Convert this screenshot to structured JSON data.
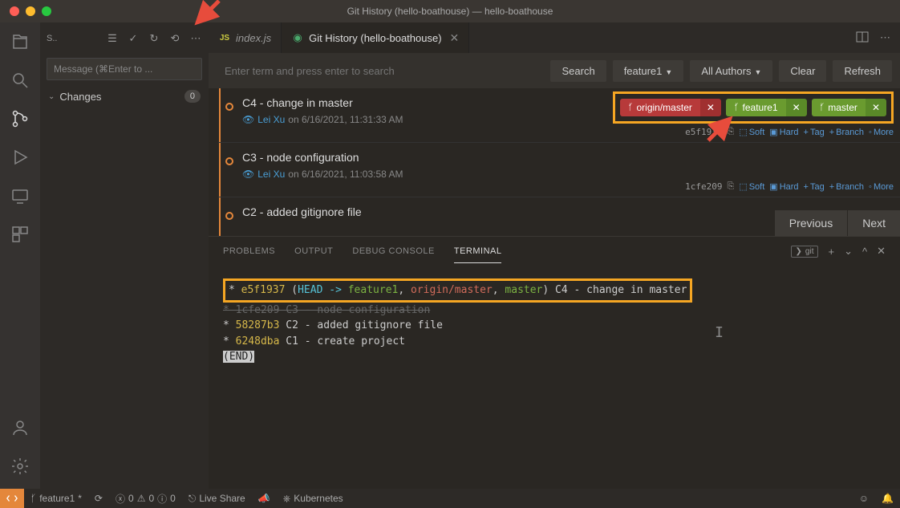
{
  "titlebar": {
    "title": "Git History (hello-boathouse) — hello-boathouse"
  },
  "sidebar": {
    "header_label": "S..",
    "message_placeholder": "Message (⌘Enter to ...",
    "changes_label": "Changes",
    "changes_count": "0"
  },
  "tabs": {
    "t0": {
      "label": "index.js"
    },
    "t1": {
      "label": "Git History (hello-boathouse)"
    }
  },
  "search": {
    "placeholder": "Enter term and press enter to search",
    "btn_search": "Search",
    "btn_branch": "feature1",
    "btn_authors": "All Authors",
    "btn_clear": "Clear",
    "btn_refresh": "Refresh"
  },
  "branches": {
    "b0": "origin/master",
    "b1": "feature1",
    "b2": "master"
  },
  "commits": {
    "c0": {
      "title": "C4 - change in master",
      "author": "Lei Xu",
      "meta": " on 6/16/2021, 11:31:33 AM",
      "hash": "e5f1937"
    },
    "c1": {
      "title": "C3 - node configuration",
      "author": "Lei Xu",
      "meta": " on 6/16/2021, 11:03:58 AM",
      "hash": "1cfe209"
    },
    "c2": {
      "title": "C2 - added gitignore file"
    }
  },
  "actions": {
    "soft": "Soft",
    "hard": "Hard",
    "tag": "Tag",
    "branch": "Branch",
    "more": "More"
  },
  "pager": {
    "prev": "Previous",
    "next": "Next"
  },
  "panel": {
    "problems": "PROBLEMS",
    "output": "OUTPUT",
    "debug": "DEBUG CONSOLE",
    "terminal": "TERMINAL",
    "shell": "git"
  },
  "terminal": {
    "l0_hash": "e5f1937",
    "l0_head": "HEAD -> ",
    "l0_b1": "feature1",
    "l0_b2": "origin/master",
    "l0_b3": "master",
    "l0_msg": " C4 - change in master",
    "l1": "* 1cfe209 C3 - node configuration",
    "l2_hash": "58287b3",
    "l2_msg": " C2 - added gitignore file",
    "l3_hash": "6248dba",
    "l3_msg": " C1 - create project",
    "end": "(END)"
  },
  "status": {
    "branch": "feature1",
    "sync": "",
    "errors": "0",
    "warnings": "0",
    "info": "0",
    "live_share": "Live Share",
    "kubernetes": "Kubernetes"
  }
}
